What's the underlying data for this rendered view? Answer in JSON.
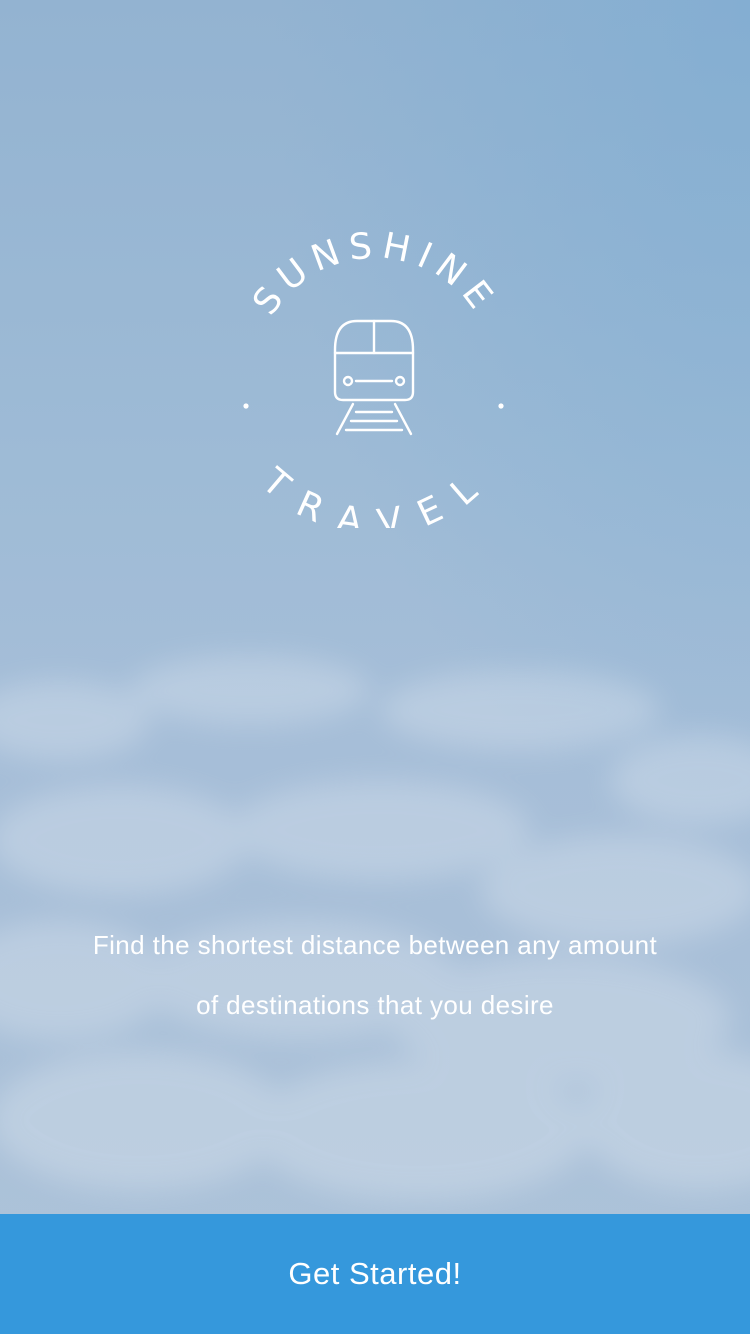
{
  "brand": {
    "name_top": "SUNSHINE",
    "name_bottom": "TRAVEL",
    "logo_icon": "train-icon"
  },
  "tagline": {
    "line1": "Find the shortest distance between any amount",
    "line2": "of destinations that you desire"
  },
  "cta": {
    "label": "Get Started!"
  },
  "colors": {
    "sky_top": "#93b3d1",
    "sky_bottom": "#adc3d9",
    "button": "#3598dc",
    "text": "#ffffff"
  }
}
